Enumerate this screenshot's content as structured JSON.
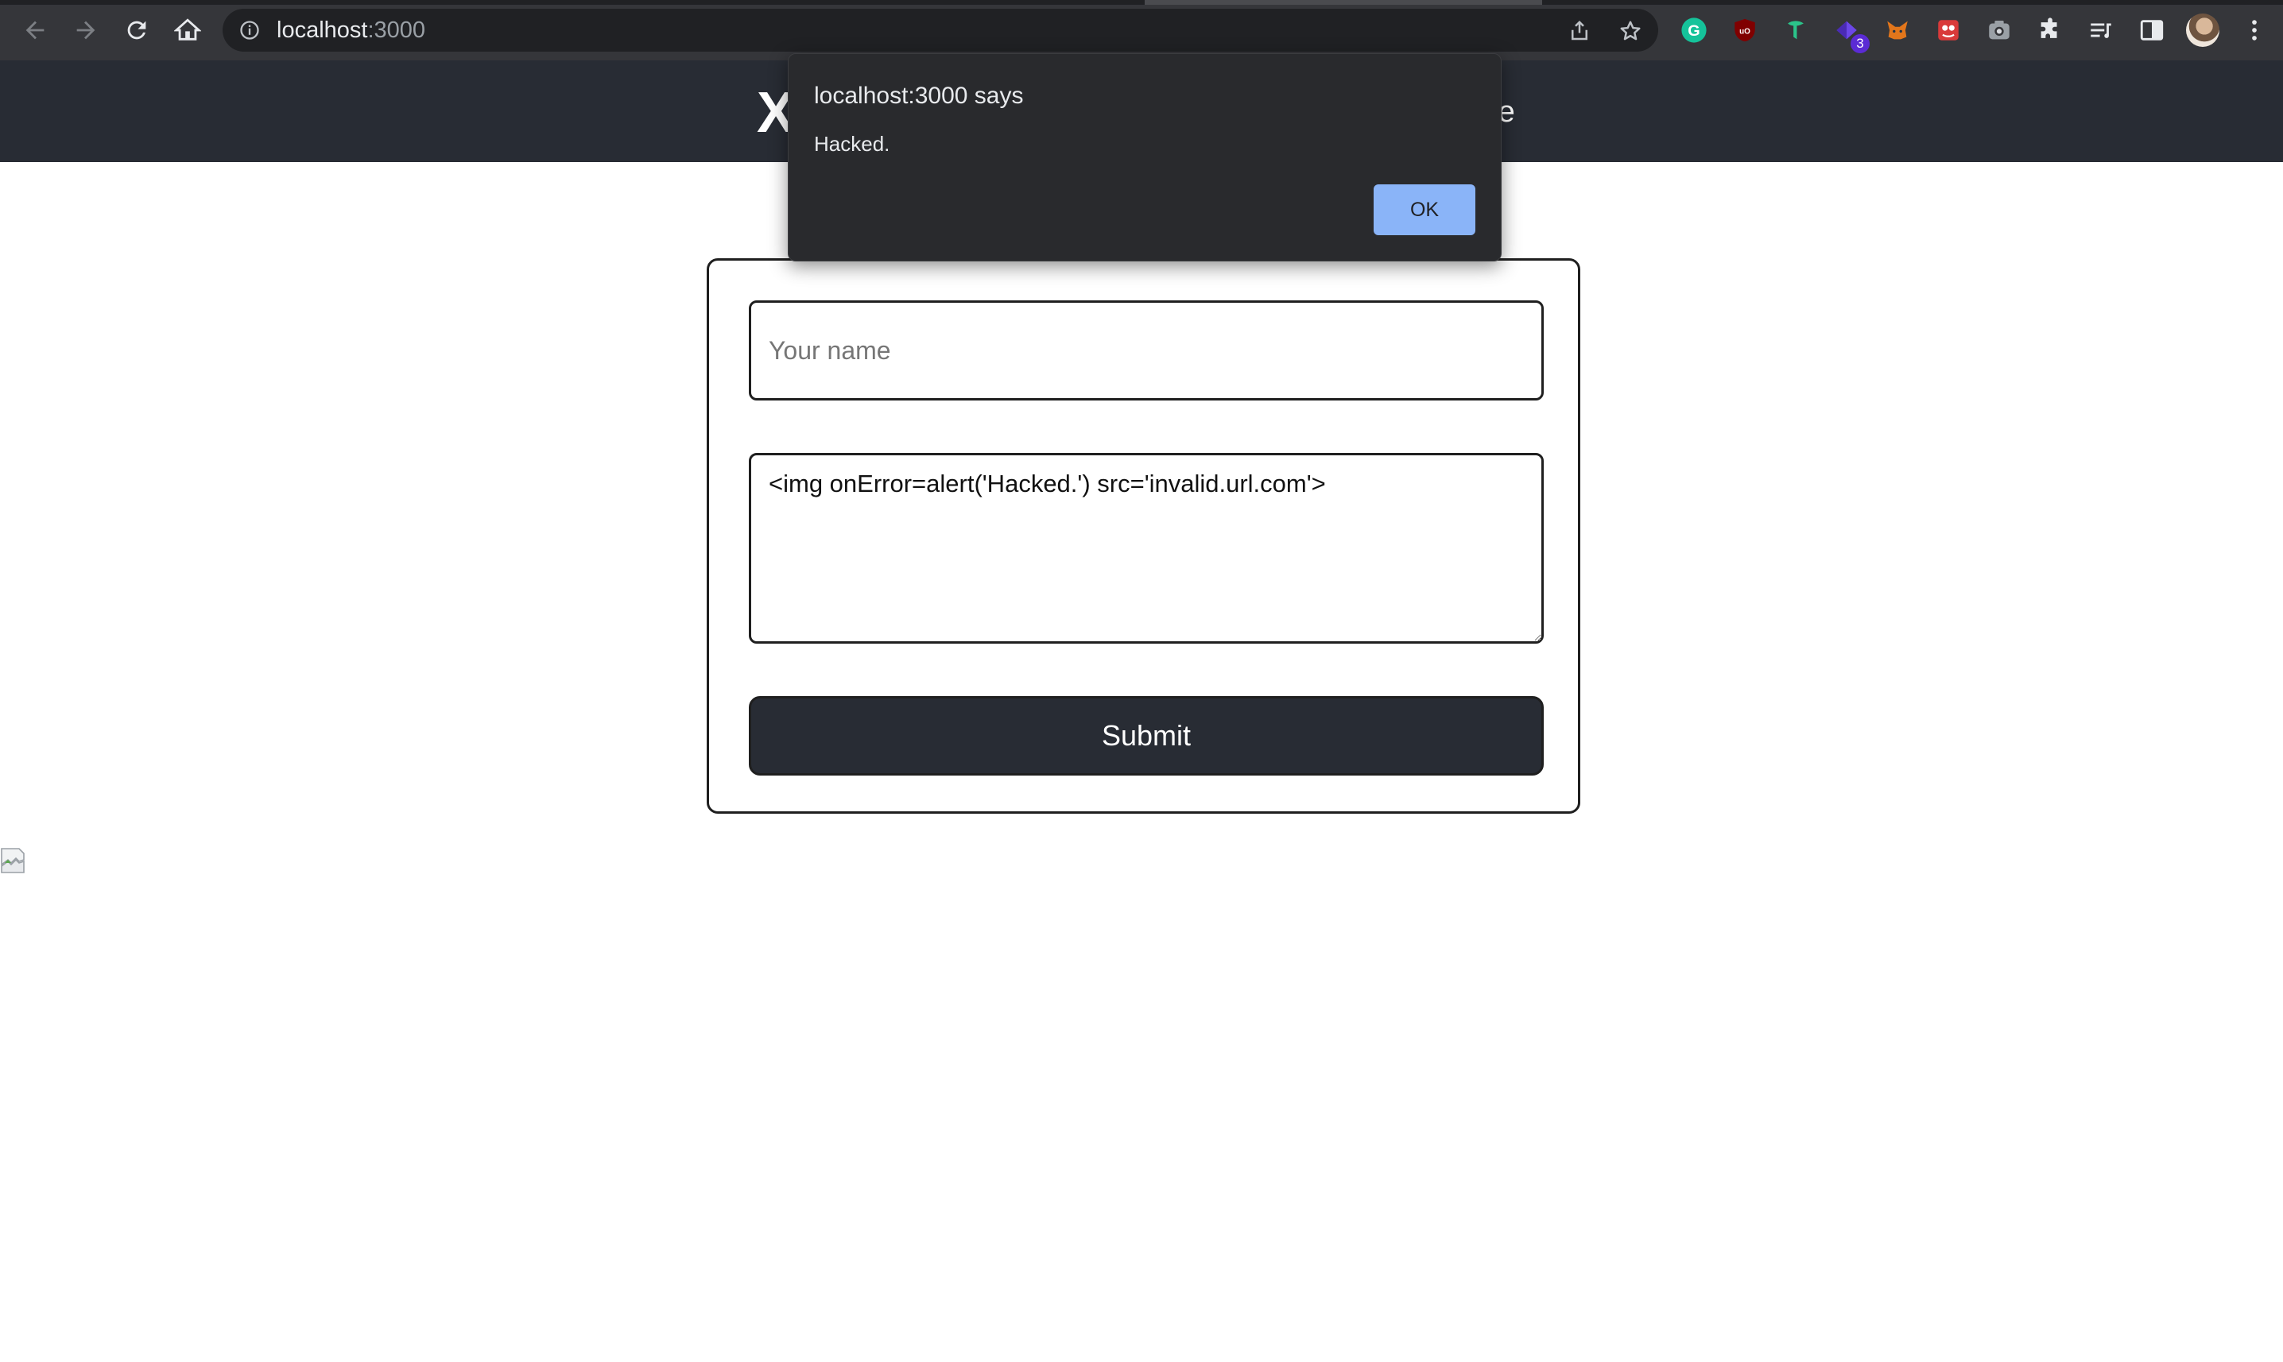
{
  "browser": {
    "url_host": "localhost",
    "url_port": ":3000",
    "extension_badge": "3"
  },
  "site": {
    "logo_text": "X",
    "nav_right_text": "re"
  },
  "form": {
    "name_placeholder": "Your name",
    "name_value": "",
    "comment_value": "<img onError=alert('Hacked.') src='invalid.url.com'>",
    "submit_label": "Submit"
  },
  "alert": {
    "title": "localhost:3000 says",
    "message": "Hacked.",
    "ok_label": "OK"
  },
  "colors": {
    "chrome_bg": "#35363a",
    "header_bg": "#282c34",
    "dialog_bg": "#292a2d",
    "dialog_button": "#8ab4f8"
  },
  "icons": {
    "toolbar": [
      "back-arrow-icon",
      "forward-arrow-icon",
      "reload-icon",
      "home-icon",
      "site-info-icon",
      "share-icon",
      "bookmark-star-icon"
    ],
    "extensions": [
      "grammarly-icon",
      "ublock-icon",
      "extension-green-icon",
      "extension-purple-icon",
      "metamask-icon",
      "extension-red-icon",
      "screenshot-camera-icon",
      "puzzle-extensions-icon",
      "reading-list-icon",
      "side-panel-icon"
    ],
    "menu": "more-vert-icon"
  }
}
